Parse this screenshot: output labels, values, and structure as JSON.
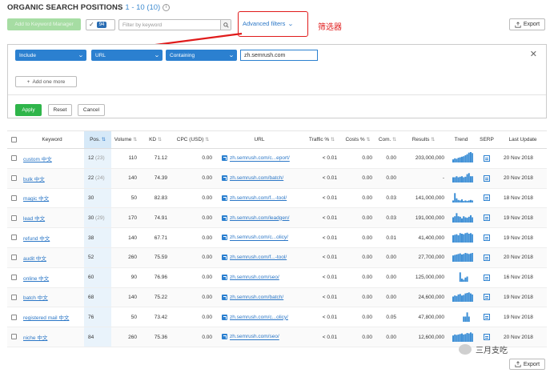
{
  "header": {
    "title": "ORGANIC SEARCH POSITIONS",
    "count": "1 - 10 (10)",
    "info_icon": "i"
  },
  "toolbar": {
    "add_button": "Add to Keyword Manager",
    "check_badge": "94",
    "filter_placeholder": "Filter by keyword",
    "advanced_filters": "Advanced filters",
    "annotation": "筛选器",
    "export": "Export"
  },
  "filter_panel": {
    "include": "Include",
    "field": "URL",
    "operator": "Containing",
    "value": "zh.semrush.com",
    "add_more": "Add one more",
    "apply": "Apply",
    "reset": "Reset",
    "cancel": "Cancel"
  },
  "table": {
    "columns": [
      "Keyword",
      "Pos.",
      "Volume",
      "KD",
      "CPC (USD)",
      "URL",
      "Traffic %",
      "Costs %",
      "Com.",
      "Results",
      "Trend",
      "SERP",
      "Last Update"
    ],
    "rows": [
      {
        "keyword": "custom 中文",
        "pos": "12",
        "prev": "(23)",
        "volume": "110",
        "kd": "71.12",
        "cpc": "0.00",
        "url": "zh.semrush.com/c...eport/",
        "traffic": "< 0.01",
        "costs": "0.00",
        "com": "0.00",
        "results": "203,000,000",
        "trend": [
          0.3,
          0.4,
          0.35,
          0.45,
          0.5,
          0.55,
          0.6,
          0.7,
          0.8,
          0.95,
          1.0,
          0.9
        ],
        "date": "20 Nov 2018"
      },
      {
        "keyword": "bulk 中文",
        "pos": "22",
        "prev": "(24)",
        "volume": "140",
        "kd": "74.39",
        "cpc": "0.00",
        "url": "zh.semrush.com/batch/",
        "traffic": "< 0.01",
        "costs": "0.00",
        "com": "0.00",
        "results": "-",
        "trend": [
          0.5,
          0.5,
          0.6,
          0.5,
          0.55,
          0.6,
          0.5,
          0.55,
          0.8,
          0.9,
          0.6,
          0.6
        ],
        "date": "20 Nov 2018"
      },
      {
        "keyword": "magic 中文",
        "pos": "30",
        "prev": "",
        "volume": "50",
        "kd": "82.83",
        "cpc": "0.00",
        "url": "zh.semrush.com/f...-tool/",
        "traffic": "< 0.01",
        "costs": "0.00",
        "com": "0.03",
        "results": "141,000,000",
        "trend": [
          0.2,
          0.9,
          0.4,
          0.25,
          0.2,
          0.3,
          0.15,
          0.2,
          0.15,
          0.2,
          0.25,
          0.2
        ],
        "date": "18 Nov 2018"
      },
      {
        "keyword": "lead 中文",
        "pos": "30",
        "prev": "(29)",
        "volume": "170",
        "kd": "74.91",
        "cpc": "0.00",
        "url": "zh.semrush.com/leadgen/",
        "traffic": "< 0.01",
        "costs": "0.00",
        "com": "0.03",
        "results": "191,000,000",
        "trend": [
          0.5,
          0.6,
          0.9,
          0.6,
          0.55,
          0.4,
          0.6,
          0.5,
          0.45,
          0.55,
          0.7,
          0.5
        ],
        "date": "19 Nov 2018"
      },
      {
        "keyword": "refund 中文",
        "pos": "38",
        "prev": "",
        "volume": "140",
        "kd": "67.71",
        "cpc": "0.00",
        "url": "zh.semrush.com/c...olicy/",
        "traffic": "< 0.01",
        "costs": "0.00",
        "com": "0.01",
        "results": "41,400,000",
        "trend": [
          0.7,
          0.75,
          0.8,
          0.7,
          0.9,
          0.85,
          0.8,
          0.9,
          0.95,
          0.85,
          0.9,
          0.8
        ],
        "date": "19 Nov 2018"
      },
      {
        "keyword": "audit 中文",
        "pos": "52",
        "prev": "",
        "volume": "260",
        "kd": "75.59",
        "cpc": "0.00",
        "url": "zh.semrush.com/f...-tool/",
        "traffic": "< 0.01",
        "costs": "0.00",
        "com": "0.00",
        "results": "27,700,000",
        "trend": [
          0.6,
          0.65,
          0.7,
          0.75,
          0.8,
          0.7,
          0.75,
          0.85,
          0.8,
          0.75,
          0.8,
          0.85
        ],
        "date": "20 Nov 2018"
      },
      {
        "keyword": "online 中文",
        "pos": "60",
        "prev": "",
        "volume": "90",
        "kd": "76.96",
        "cpc": "0.00",
        "url": "zh.semrush.com/seo/",
        "traffic": "< 0.01",
        "costs": "0.00",
        "com": "0.00",
        "results": "125,000,000",
        "trend": [
          0,
          0,
          0,
          0,
          0.9,
          0.3,
          0.2,
          0.4,
          0.5,
          0,
          0,
          0
        ],
        "date": "16 Nov 2018"
      },
      {
        "keyword": "batch 中文",
        "pos": "68",
        "prev": "",
        "volume": "140",
        "kd": "75.22",
        "cpc": "0.00",
        "url": "zh.semrush.com/batch/",
        "traffic": "< 0.01",
        "costs": "0.00",
        "com": "0.00",
        "results": "24,600,000",
        "trend": [
          0.5,
          0.6,
          0.55,
          0.7,
          0.75,
          0.6,
          0.65,
          0.8,
          0.85,
          0.9,
          0.8,
          0.7
        ],
        "date": "19 Nov 2018"
      },
      {
        "keyword": "registered mail 中文",
        "pos": "76",
        "prev": "",
        "volume": "50",
        "kd": "73.42",
        "cpc": "0.00",
        "url": "zh.semrush.com/c...olicy/",
        "traffic": "< 0.01",
        "costs": "0.00",
        "com": "0.05",
        "results": "47,800,000",
        "trend": [
          0,
          0,
          0,
          0,
          0,
          0,
          0.5,
          0.5,
          0.9,
          0.5,
          0,
          0
        ],
        "date": "19 Nov 2018"
      },
      {
        "keyword": "niche 中文",
        "pos": "84",
        "prev": "",
        "volume": "260",
        "kd": "75.36",
        "cpc": "0.00",
        "url": "zh.semrush.com/seo/",
        "traffic": "< 0.01",
        "costs": "0.00",
        "com": "0.00",
        "results": "12,600,000",
        "trend": [
          0.6,
          0.7,
          0.65,
          0.7,
          0.75,
          0.8,
          0.7,
          0.75,
          0.85,
          0.8,
          0.9,
          0.8
        ],
        "date": "20 Nov 2018"
      }
    ]
  },
  "watermark": "三月支吃",
  "colors": {
    "brand_blue": "#2b80d0",
    "link_blue": "#2b77c7",
    "apply_green": "#2fb54a",
    "annotation_red": "#e01b1b"
  }
}
